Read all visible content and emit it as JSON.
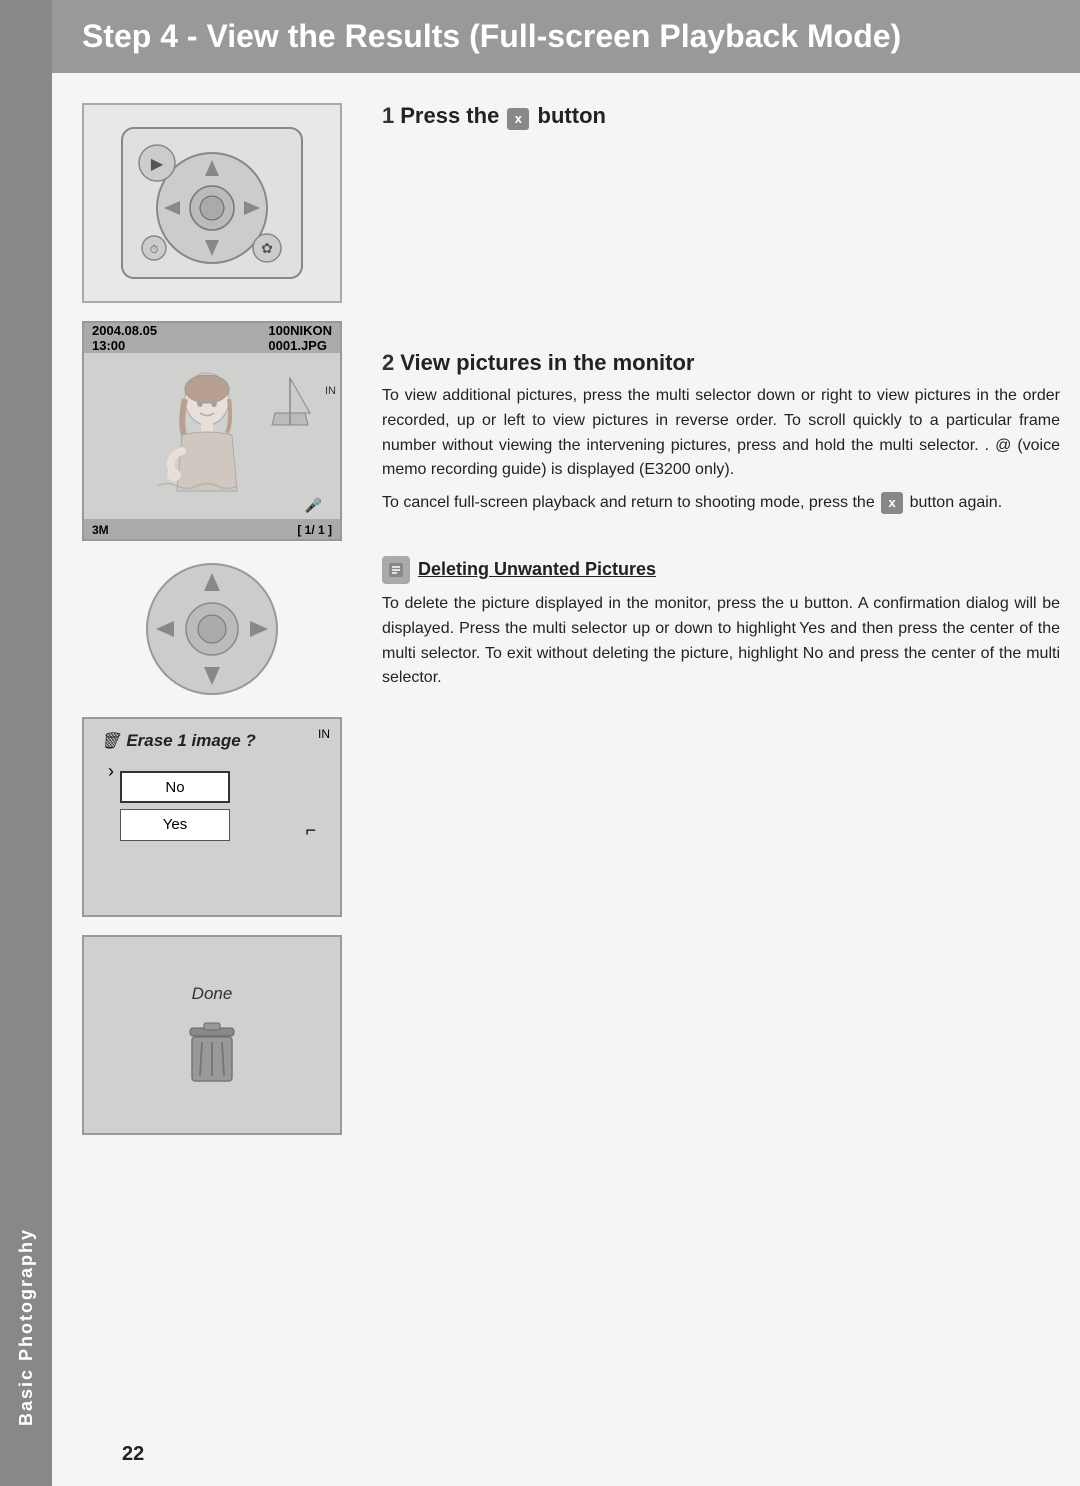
{
  "sidebar": {
    "label": "Basic Photography"
  },
  "header": {
    "title": "Step 4 - View the Results (Full-screen Playback Mode)"
  },
  "step1": {
    "number": "1",
    "title": "Press the x   button",
    "body": ""
  },
  "step2": {
    "number": "2",
    "title": "View pictures in the monitor",
    "body1": "To view additional pictures, press the multi selector down or right to view pictures in the order recorded, up or left to view pictures in reverse order. To scroll quickly to a particular frame number without viewing the intervening pictures, press and hold the multi selector. .    @ (voice memo recording guide) is displayed (E3200 only).",
    "body2": "To cancel full-screen playback and return to shooting mode, press the x   button again."
  },
  "note": {
    "title": "Deleting Unwanted Pictures",
    "body": "To delete the picture displayed in the monitor, press the u  button. A confirmation dialog will be displayed. Press the multi selector up or down to highlight Yes and then press the center of the multi selector. To exit without deleting the picture, highlight  No and press the center of the multi selector."
  },
  "monitor": {
    "date": "2004.08.05",
    "time": "13:00",
    "folder": "100NIKON",
    "file": "0001.JPG",
    "badge": "3M",
    "frame": "[ 1/  1 ]",
    "mode_icon": "IN"
  },
  "erase_dialog": {
    "icon": "🗑",
    "text": "Erase 1 image ?",
    "no_label": "No",
    "yes_label": "Yes",
    "mode_icon": "IN"
  },
  "done_box": {
    "label": "Done"
  },
  "page_number": "22"
}
